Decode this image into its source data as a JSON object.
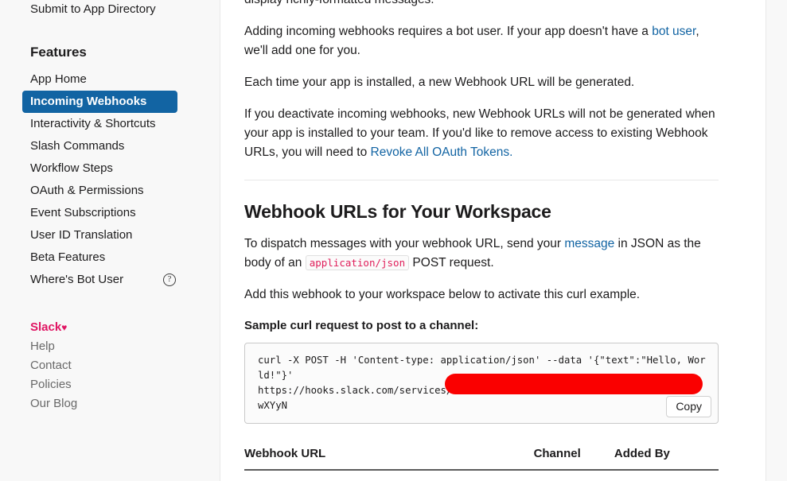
{
  "sidebar": {
    "top_link": {
      "label": "Submit to App Directory"
    },
    "section_title": "Features",
    "items": [
      {
        "label": "App Home",
        "active": false
      },
      {
        "label": "Incoming Webhooks",
        "active": true
      },
      {
        "label": "Interactivity & Shortcuts",
        "active": false
      },
      {
        "label": "Slash Commands",
        "active": false
      },
      {
        "label": "Workflow Steps",
        "active": false
      },
      {
        "label": "OAuth & Permissions",
        "active": false
      },
      {
        "label": "Event Subscriptions",
        "active": false
      },
      {
        "label": "User ID Translation",
        "active": false
      },
      {
        "label": "Beta Features",
        "active": false
      },
      {
        "label": "Where's Bot User",
        "active": false,
        "help_icon": "question-mark-circle-icon"
      }
    ],
    "footer": {
      "brand_label": "Slack",
      "brand_heart": "♥",
      "links": [
        {
          "label": "Help"
        },
        {
          "label": "Contact"
        },
        {
          "label": "Policies"
        },
        {
          "label": "Our Blog"
        }
      ]
    },
    "accent_color": "#1264a3",
    "brand_color": "#e01563"
  },
  "main": {
    "clipped_paragraph": "display richly-formatted messages.",
    "paragraph_bot_user": {
      "before": "Adding incoming webhooks requires a bot user. If your app doesn't have a ",
      "link": "bot user",
      "after": ", we'll add one for you."
    },
    "paragraph_each_time": "Each time your app is installed, a new Webhook URL will be generated.",
    "paragraph_deactivate": {
      "before": "If you deactivate incoming webhooks, new Webhook URLs will not be generated when your app is installed to your team. If you'd like to remove access to existing Webhook URLs, you will need to ",
      "link": "Revoke All OAuth Tokens."
    },
    "section_heading": "Webhook URLs for Your Workspace",
    "paragraph_dispatch": {
      "before": "To dispatch messages with your webhook URL, send your ",
      "link": "message",
      "mid": " in JSON as the body of an ",
      "code": "application/json",
      "after": " POST request."
    },
    "paragraph_activate": "Add this webhook to your workspace below to activate this curl example.",
    "sample_label": "Sample curl request to post to a channel:",
    "code_block": {
      "text": "curl -X POST -H 'Content-type: application/json' --data '{\"text\":\"Hello, World!\"}'\nhttps://hooks.slack.com/services/\nwXYyN",
      "redaction_color": "#fa0000",
      "copy_label": "Copy"
    },
    "table": {
      "headers": [
        "Webhook URL",
        "Channel",
        "Added By"
      ],
      "rows": []
    },
    "link_color": "#1264a3",
    "code_color": "#e01e5a"
  }
}
